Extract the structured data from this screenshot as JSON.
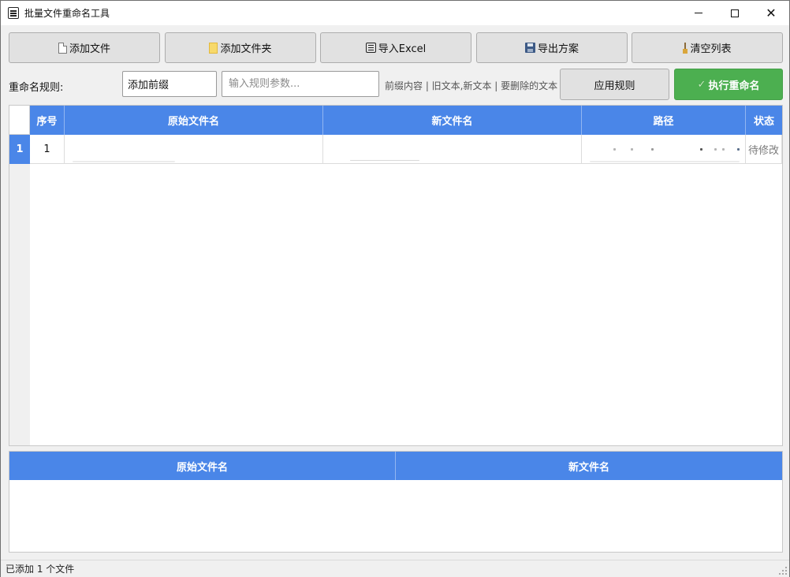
{
  "window": {
    "title": "批量文件重命名工具"
  },
  "toolbar": {
    "add_file": "添加文件",
    "add_folder": "添加文件夹",
    "import_excel": "导入Excel",
    "export_scheme": "导出方案",
    "clear_list": "清空列表"
  },
  "rule": {
    "label": "重命名规则:",
    "selected": "添加前缀",
    "param_placeholder": "输入规则参数...",
    "hint": "前缀内容 | 旧文本,新文本 | 要删除的文本",
    "apply": "应用规则",
    "execute": "执行重命名"
  },
  "table": {
    "headers": {
      "index": "序号",
      "original": "原始文件名",
      "new": "新文件名",
      "path": "路径",
      "status": "状态"
    },
    "rows": [
      {
        "row_header": "1",
        "index": "1",
        "original": "",
        "new": "",
        "path": "",
        "status": "待修改"
      }
    ]
  },
  "preview": {
    "headers": {
      "original": "原始文件名",
      "new": "新文件名"
    }
  },
  "status_bar": {
    "text": "已添加 1 个文件"
  },
  "colors": {
    "header_blue": "#4a86e8",
    "execute_green": "#4caf50"
  }
}
